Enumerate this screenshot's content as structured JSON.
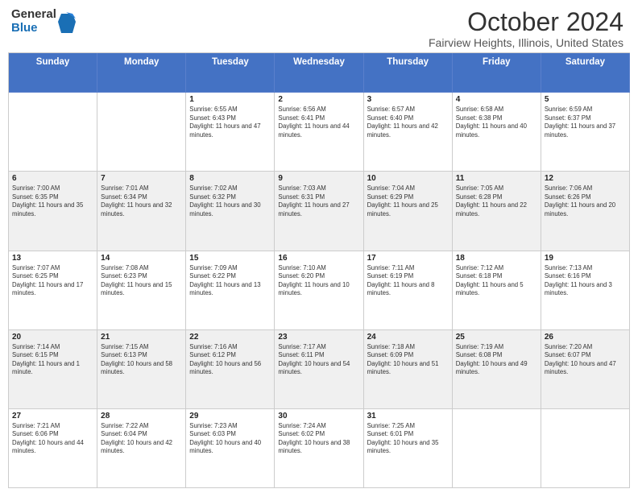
{
  "logo": {
    "general": "General",
    "blue": "Blue"
  },
  "title": {
    "month": "October 2024",
    "location": "Fairview Heights, Illinois, United States"
  },
  "headers": [
    "Sunday",
    "Monday",
    "Tuesday",
    "Wednesday",
    "Thursday",
    "Friday",
    "Saturday"
  ],
  "rows": [
    [
      {
        "date": "",
        "info": "",
        "shaded": false,
        "empty": true
      },
      {
        "date": "",
        "info": "",
        "shaded": false,
        "empty": true
      },
      {
        "date": "1",
        "info": "Sunrise: 6:55 AM\nSunset: 6:43 PM\nDaylight: 11 hours and 47 minutes.",
        "shaded": false
      },
      {
        "date": "2",
        "info": "Sunrise: 6:56 AM\nSunset: 6:41 PM\nDaylight: 11 hours and 44 minutes.",
        "shaded": false
      },
      {
        "date": "3",
        "info": "Sunrise: 6:57 AM\nSunset: 6:40 PM\nDaylight: 11 hours and 42 minutes.",
        "shaded": false
      },
      {
        "date": "4",
        "info": "Sunrise: 6:58 AM\nSunset: 6:38 PM\nDaylight: 11 hours and 40 minutes.",
        "shaded": false
      },
      {
        "date": "5",
        "info": "Sunrise: 6:59 AM\nSunset: 6:37 PM\nDaylight: 11 hours and 37 minutes.",
        "shaded": false
      }
    ],
    [
      {
        "date": "6",
        "info": "Sunrise: 7:00 AM\nSunset: 6:35 PM\nDaylight: 11 hours and 35 minutes.",
        "shaded": true
      },
      {
        "date": "7",
        "info": "Sunrise: 7:01 AM\nSunset: 6:34 PM\nDaylight: 11 hours and 32 minutes.",
        "shaded": true
      },
      {
        "date": "8",
        "info": "Sunrise: 7:02 AM\nSunset: 6:32 PM\nDaylight: 11 hours and 30 minutes.",
        "shaded": true
      },
      {
        "date": "9",
        "info": "Sunrise: 7:03 AM\nSunset: 6:31 PM\nDaylight: 11 hours and 27 minutes.",
        "shaded": true
      },
      {
        "date": "10",
        "info": "Sunrise: 7:04 AM\nSunset: 6:29 PM\nDaylight: 11 hours and 25 minutes.",
        "shaded": true
      },
      {
        "date": "11",
        "info": "Sunrise: 7:05 AM\nSunset: 6:28 PM\nDaylight: 11 hours and 22 minutes.",
        "shaded": true
      },
      {
        "date": "12",
        "info": "Sunrise: 7:06 AM\nSunset: 6:26 PM\nDaylight: 11 hours and 20 minutes.",
        "shaded": true
      }
    ],
    [
      {
        "date": "13",
        "info": "Sunrise: 7:07 AM\nSunset: 6:25 PM\nDaylight: 11 hours and 17 minutes.",
        "shaded": false
      },
      {
        "date": "14",
        "info": "Sunrise: 7:08 AM\nSunset: 6:23 PM\nDaylight: 11 hours and 15 minutes.",
        "shaded": false
      },
      {
        "date": "15",
        "info": "Sunrise: 7:09 AM\nSunset: 6:22 PM\nDaylight: 11 hours and 13 minutes.",
        "shaded": false
      },
      {
        "date": "16",
        "info": "Sunrise: 7:10 AM\nSunset: 6:20 PM\nDaylight: 11 hours and 10 minutes.",
        "shaded": false
      },
      {
        "date": "17",
        "info": "Sunrise: 7:11 AM\nSunset: 6:19 PM\nDaylight: 11 hours and 8 minutes.",
        "shaded": false
      },
      {
        "date": "18",
        "info": "Sunrise: 7:12 AM\nSunset: 6:18 PM\nDaylight: 11 hours and 5 minutes.",
        "shaded": false
      },
      {
        "date": "19",
        "info": "Sunrise: 7:13 AM\nSunset: 6:16 PM\nDaylight: 11 hours and 3 minutes.",
        "shaded": false
      }
    ],
    [
      {
        "date": "20",
        "info": "Sunrise: 7:14 AM\nSunset: 6:15 PM\nDaylight: 11 hours and 1 minute.",
        "shaded": true
      },
      {
        "date": "21",
        "info": "Sunrise: 7:15 AM\nSunset: 6:13 PM\nDaylight: 10 hours and 58 minutes.",
        "shaded": true
      },
      {
        "date": "22",
        "info": "Sunrise: 7:16 AM\nSunset: 6:12 PM\nDaylight: 10 hours and 56 minutes.",
        "shaded": true
      },
      {
        "date": "23",
        "info": "Sunrise: 7:17 AM\nSunset: 6:11 PM\nDaylight: 10 hours and 54 minutes.",
        "shaded": true
      },
      {
        "date": "24",
        "info": "Sunrise: 7:18 AM\nSunset: 6:09 PM\nDaylight: 10 hours and 51 minutes.",
        "shaded": true
      },
      {
        "date": "25",
        "info": "Sunrise: 7:19 AM\nSunset: 6:08 PM\nDaylight: 10 hours and 49 minutes.",
        "shaded": true
      },
      {
        "date": "26",
        "info": "Sunrise: 7:20 AM\nSunset: 6:07 PM\nDaylight: 10 hours and 47 minutes.",
        "shaded": true
      }
    ],
    [
      {
        "date": "27",
        "info": "Sunrise: 7:21 AM\nSunset: 6:06 PM\nDaylight: 10 hours and 44 minutes.",
        "shaded": false
      },
      {
        "date": "28",
        "info": "Sunrise: 7:22 AM\nSunset: 6:04 PM\nDaylight: 10 hours and 42 minutes.",
        "shaded": false
      },
      {
        "date": "29",
        "info": "Sunrise: 7:23 AM\nSunset: 6:03 PM\nDaylight: 10 hours and 40 minutes.",
        "shaded": false
      },
      {
        "date": "30",
        "info": "Sunrise: 7:24 AM\nSunset: 6:02 PM\nDaylight: 10 hours and 38 minutes.",
        "shaded": false
      },
      {
        "date": "31",
        "info": "Sunrise: 7:25 AM\nSunset: 6:01 PM\nDaylight: 10 hours and 35 minutes.",
        "shaded": false
      },
      {
        "date": "",
        "info": "",
        "shaded": false,
        "empty": true
      },
      {
        "date": "",
        "info": "",
        "shaded": false,
        "empty": true
      }
    ]
  ]
}
